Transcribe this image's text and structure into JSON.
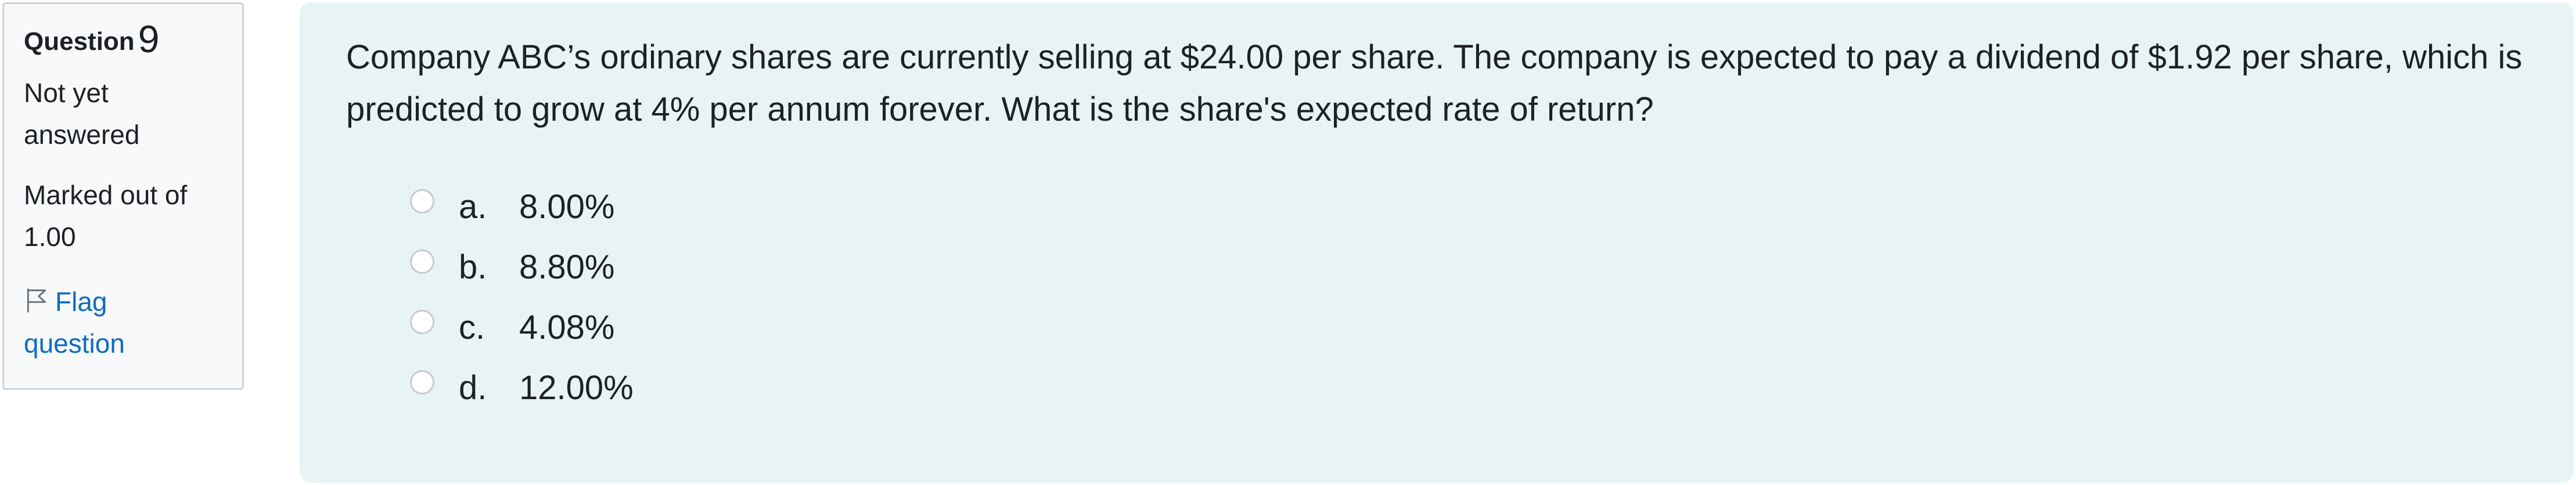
{
  "info": {
    "question_label": "Question",
    "question_number": "9",
    "state": "Not yet answered",
    "grade": "Marked out of 1.00",
    "flag_label": "Flag question"
  },
  "question": {
    "text": "Company ABC’s ordinary shares are currently selling at $24.00 per share. The company is expected to pay a dividend of $1.92 per share, which is predicted to grow at  4% per annum forever. What is the share's expected rate of return?"
  },
  "answers": [
    {
      "letter": "a.",
      "text": "8.00%"
    },
    {
      "letter": "b.",
      "text": "8.80%"
    },
    {
      "letter": "c.",
      "text": "4.08%"
    },
    {
      "letter": "d.",
      "text": "12.00%"
    }
  ],
  "colors": {
    "panel_bg": "#e7f3f5",
    "info_bg": "#f8f9fa",
    "link": "#0f6cbf",
    "text": "#1d2125"
  },
  "icons": {
    "flag": "flag-icon",
    "radio": "radio-unchecked-icon"
  }
}
